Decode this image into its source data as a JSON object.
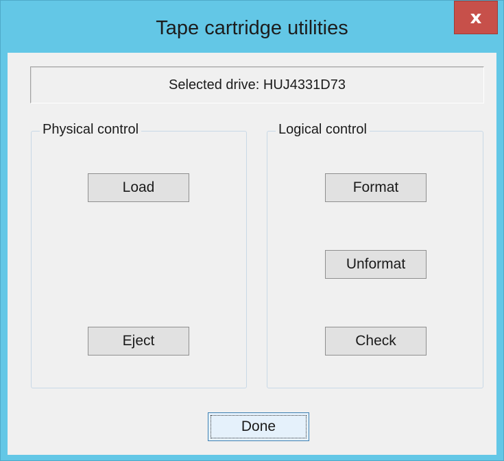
{
  "window": {
    "title": "Tape cartridge utilities",
    "close_glyph": "x",
    "close_icon": "close-icon"
  },
  "drive": {
    "label": "Selected drive: HUJ4331D73"
  },
  "physical": {
    "title": "Physical control",
    "load_label": "Load",
    "eject_label": "Eject"
  },
  "logical": {
    "title": "Logical control",
    "format_label": "Format",
    "unformat_label": "Unformat",
    "check_label": "Check"
  },
  "footer": {
    "done_label": "Done"
  },
  "colors": {
    "frame": "#63c7e6",
    "close_button": "#c7504a",
    "client_background": "#f0f0f0",
    "button_face": "#e1e1e1",
    "default_button_face": "#e5f1fb",
    "default_button_border": "#3c7fb1"
  }
}
